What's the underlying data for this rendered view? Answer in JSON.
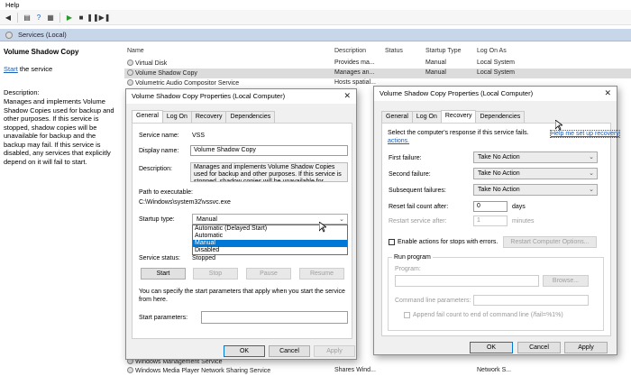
{
  "menu": {
    "help": "Help"
  },
  "subbar": {
    "title": "Services (Local)"
  },
  "left_panel": {
    "title": "Volume Shadow Copy",
    "start_link": "Start",
    "start_suffix": " the service",
    "desc_label": "Description:",
    "description": "Manages and implements Volume Shadow Copies used for backup and other purposes. If this service is stopped, shadow copies will be unavailable for backup and the backup may fail. If this service is disabled, any services that explicitly depend on it will fail to start."
  },
  "columns": {
    "name": "Name",
    "description": "Description",
    "status": "Status",
    "startup": "Startup Type",
    "logon": "Log On As"
  },
  "services": [
    {
      "name": "Virtual Disk",
      "desc": "Provides ma...",
      "status": "",
      "startup": "Manual",
      "logon": "Local System"
    },
    {
      "name": "Volume Shadow Copy",
      "desc": "Manages an...",
      "status": "",
      "startup": "Manual",
      "logon": "Local System"
    },
    {
      "name": "Volumetric Audio Compositor Service",
      "desc": "Hosts spatial...",
      "status": "",
      "startup": "",
      "logon": ""
    },
    {
      "name": "Windows Management Service",
      "desc": "",
      "status": "",
      "startup": "",
      "logon": ""
    },
    {
      "name": "Windows Media Player Network Sharing Service",
      "desc": "Shares Wind...",
      "status": "",
      "startup": "",
      "logon": "Network S..."
    }
  ],
  "general_dlg": {
    "title": "Volume Shadow Copy Properties (Local Computer)",
    "tabs": [
      "General",
      "Log On",
      "Recovery",
      "Dependencies"
    ],
    "service_name_label": "Service name:",
    "service_name": "VSS",
    "display_name_label": "Display name:",
    "display_name": "Volume Shadow Copy",
    "description_label": "Description:",
    "description_text": "Manages and implements Volume Shadow Copies used for backup and other purposes. If this service is stopped, shadow copies will be unavailable for",
    "path_label": "Path to executable:",
    "path": "C:\\Windows\\system32\\vssvc.exe",
    "startup_label": "Startup type:",
    "startup_value": "Manual",
    "startup_options": [
      "Automatic (Delayed Start)",
      "Automatic",
      "Manual",
      "Disabled"
    ],
    "status_label": "Service status:",
    "status_value": "Stopped",
    "buttons": {
      "start": "Start",
      "stop": "Stop",
      "pause": "Pause",
      "resume": "Resume"
    },
    "hint": "You can specify the start parameters that apply when you start the service from here.",
    "params_label": "Start parameters:",
    "ok": "OK",
    "cancel": "Cancel",
    "apply": "Apply"
  },
  "recovery_dlg": {
    "title": "Volume Shadow Copy Properties (Local Computer)",
    "tabs": [
      "General",
      "Log On",
      "Recovery",
      "Dependencies"
    ],
    "prompt": "Select the computer's response if this service fails.",
    "help_link_1": "Help me set up recovery",
    "help_link_2": "actions.",
    "first_label": "First failure:",
    "first_value": "Take No Action",
    "second_label": "Second failure:",
    "second_value": "Take No Action",
    "subsequent_label": "Subsequent failures:",
    "subsequent_value": "Take No Action",
    "reset_label": "Reset fail count after:",
    "reset_value": "0",
    "reset_unit": "days",
    "restart_label": "Restart service after:",
    "restart_value": "1",
    "restart_unit": "minutes",
    "enable_stops_label": "Enable actions for stops with errors.",
    "restart_computer_btn": "Restart Computer Options...",
    "run_program_label": "Run program",
    "program_label": "Program:",
    "browse_btn": "Browse...",
    "cmdline_label": "Command line parameters:",
    "append_label": "Append fail count to end of command line (/fail=%1%)",
    "ok": "OK",
    "cancel": "Cancel",
    "apply": "Apply"
  }
}
